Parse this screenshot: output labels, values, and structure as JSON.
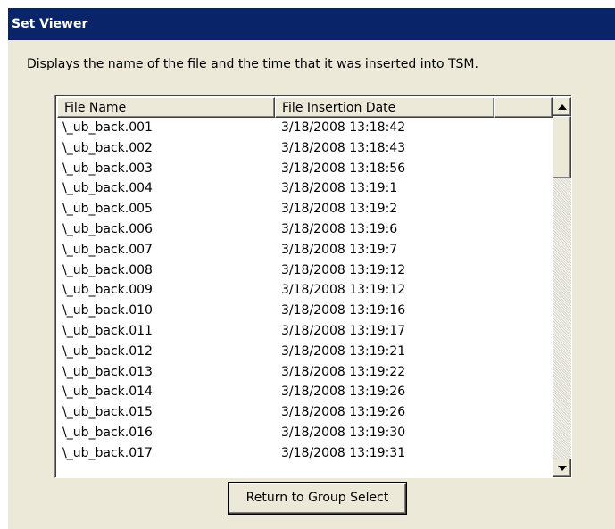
{
  "window": {
    "title": "Set Viewer"
  },
  "description": "Displays the name of the file and the time that it was inserted into TSM.",
  "list": {
    "columns": [
      "File Name",
      "File Insertion Date",
      ""
    ],
    "rows": [
      {
        "name": "\\_ub_back.001",
        "date": "3/18/2008  13:18:42"
      },
      {
        "name": "\\_ub_back.002",
        "date": "3/18/2008  13:18:43"
      },
      {
        "name": "\\_ub_back.003",
        "date": "3/18/2008  13:18:56"
      },
      {
        "name": "\\_ub_back.004",
        "date": "3/18/2008  13:19:1"
      },
      {
        "name": "\\_ub_back.005",
        "date": "3/18/2008  13:19:2"
      },
      {
        "name": "\\_ub_back.006",
        "date": "3/18/2008  13:19:6"
      },
      {
        "name": "\\_ub_back.007",
        "date": "3/18/2008  13:19:7"
      },
      {
        "name": "\\_ub_back.008",
        "date": "3/18/2008  13:19:12"
      },
      {
        "name": "\\_ub_back.009",
        "date": "3/18/2008  13:19:12"
      },
      {
        "name": "\\_ub_back.010",
        "date": "3/18/2008  13:19:16"
      },
      {
        "name": "\\_ub_back.011",
        "date": "3/18/2008  13:19:17"
      },
      {
        "name": "\\_ub_back.012",
        "date": "3/18/2008  13:19:21"
      },
      {
        "name": "\\_ub_back.013",
        "date": "3/18/2008  13:19:22"
      },
      {
        "name": "\\_ub_back.014",
        "date": "3/18/2008  13:19:26"
      },
      {
        "name": "\\_ub_back.015",
        "date": "3/18/2008  13:19:26"
      },
      {
        "name": "\\_ub_back.016",
        "date": "3/18/2008  13:19:30"
      },
      {
        "name": "\\_ub_back.017",
        "date": "3/18/2008  13:19:31"
      }
    ]
  },
  "icons": {
    "scroll_up": "scroll-up-arrow-icon",
    "scroll_down": "scroll-down-arrow-icon"
  },
  "buttons": {
    "return_label": "Return to Group Select"
  },
  "colors": {
    "titlebar": "#0a246a",
    "panel": "#ece9d8",
    "list_background": "#ffffff"
  }
}
